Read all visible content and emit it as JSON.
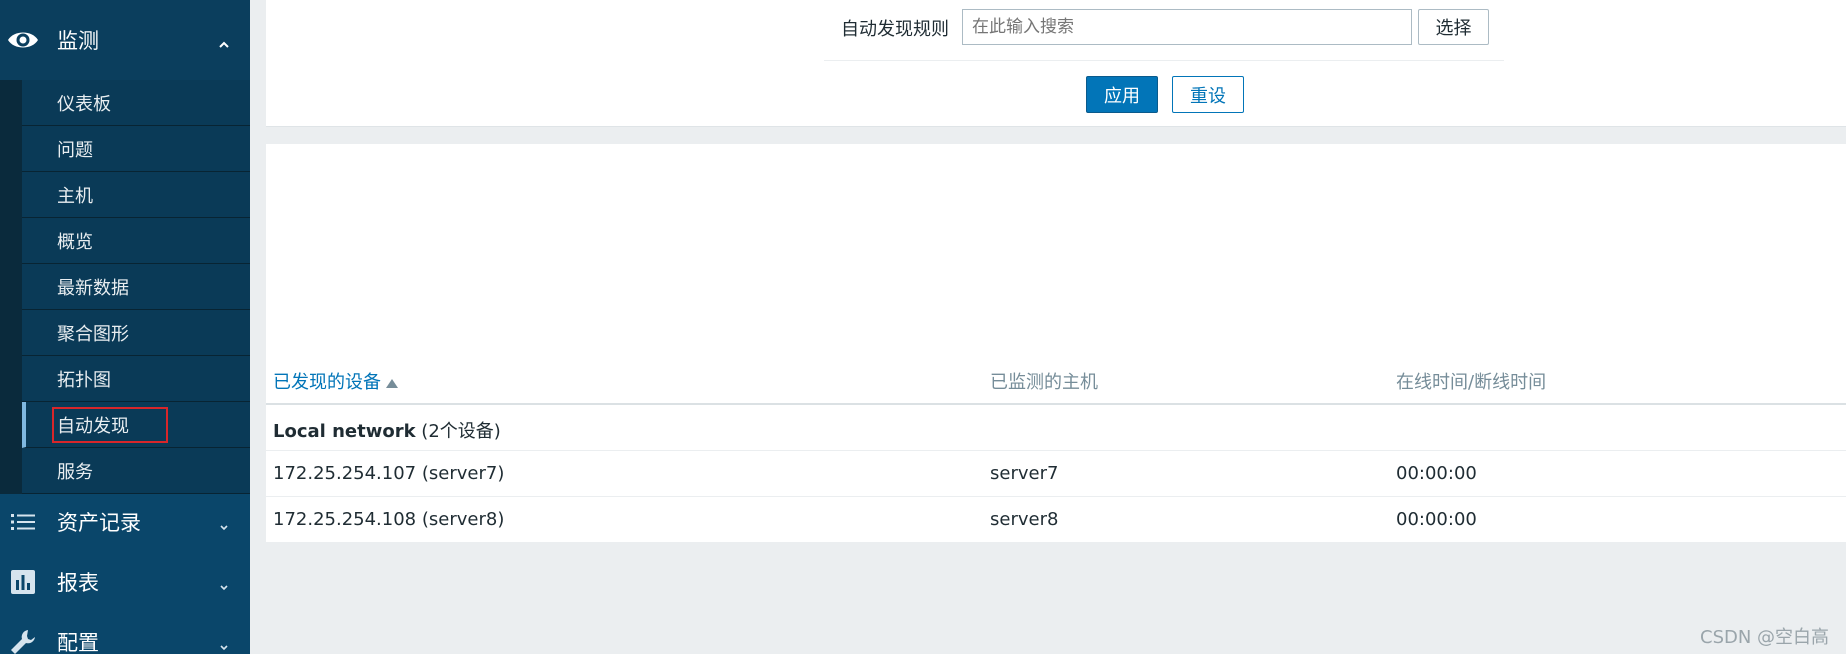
{
  "sidebar": {
    "monitoring": {
      "label": "监测",
      "icon": "eye-icon"
    },
    "submenu": [
      {
        "label": "仪表板"
      },
      {
        "label": "问题"
      },
      {
        "label": "主机"
      },
      {
        "label": "概览"
      },
      {
        "label": "最新数据"
      },
      {
        "label": "聚合图形"
      },
      {
        "label": "拓扑图"
      },
      {
        "label": "自动发现",
        "active": true
      },
      {
        "label": "服务"
      }
    ],
    "assets": {
      "label": "资产记录",
      "icon": "list-icon"
    },
    "reports": {
      "label": "报表",
      "icon": "bar-chart-icon"
    },
    "config": {
      "label": "配置",
      "icon": "wrench-icon"
    }
  },
  "filter": {
    "rule_label": "自动发现规则",
    "rule_placeholder": "在此输入搜索",
    "select_label": "选择",
    "apply_label": "应用",
    "reset_label": "重设"
  },
  "table": {
    "columns": [
      "已发现的设备",
      "已监测的主机",
      "在线时间/断线时间"
    ],
    "group": {
      "name": "Local network",
      "count": "(2个设备)"
    },
    "rows": [
      {
        "device": "172.25.254.107 (server7)",
        "host": "server7",
        "uptime": "00:00:00"
      },
      {
        "device": "172.25.254.108 (server8)",
        "host": "server8",
        "uptime": "00:00:00"
      }
    ]
  },
  "watermark": "CSDN @空白高",
  "colors": {
    "sidebar": "#0a466a",
    "accent": "#0275b8",
    "highlight": "#d8262a"
  }
}
